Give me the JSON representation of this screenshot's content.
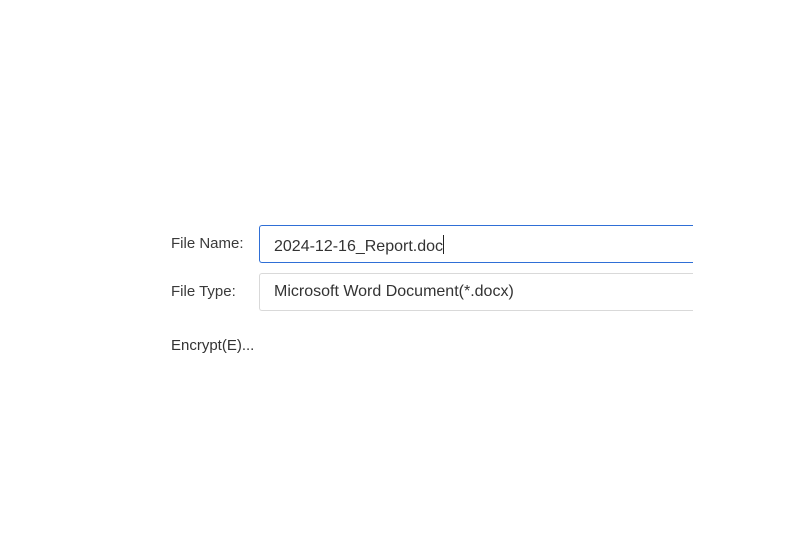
{
  "save_form": {
    "file_name_label": "File Name:",
    "file_name_value": "2024-12-16_Report.doc",
    "file_type_label": "File Type:",
    "file_type_value": "Microsoft Word Document(*.docx)",
    "encrypt_label": "Encrypt(E)..."
  },
  "colors": {
    "focus_border": "#2f6fd6",
    "field_border": "#d9d9d9",
    "text": "#333333"
  }
}
